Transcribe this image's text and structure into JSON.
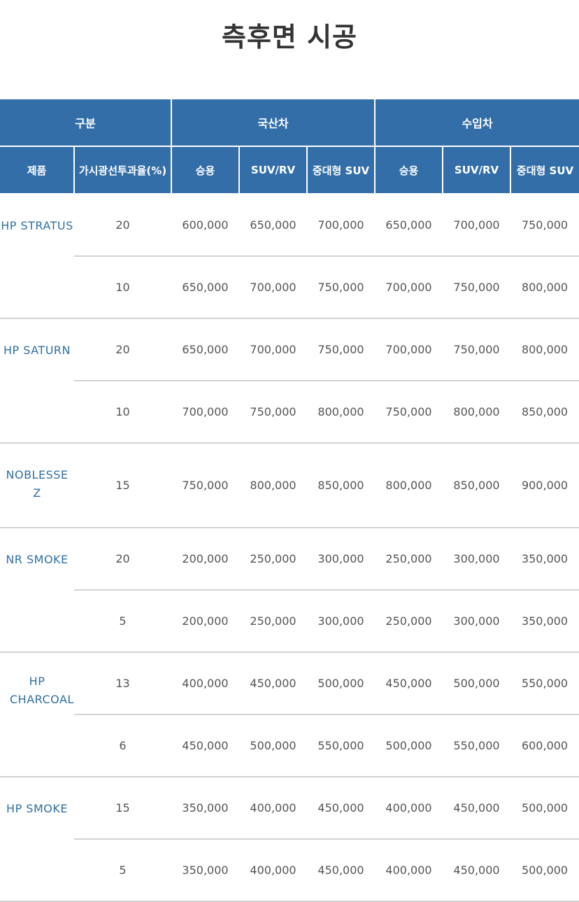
{
  "page": {
    "title": "측후면 시공"
  },
  "table": {
    "group_headers": {
      "category": "구분",
      "domestic": "국산차",
      "imported": "수입차"
    },
    "column_headers": {
      "product": "제품",
      "vlt": "가시광선투과율(%)",
      "passenger": "승용",
      "suv_rv": "SUV/RV",
      "large_suv": "중대형 SUV"
    },
    "products": [
      {
        "name": "HP STRATUS",
        "rows": [
          {
            "vlt": "20",
            "prices": [
              "600,000",
              "650,000",
              "700,000",
              "650,000",
              "700,000",
              "750,000"
            ]
          },
          {
            "vlt": "10",
            "prices": [
              "650,000",
              "700,000",
              "750,000",
              "700,000",
              "750,000",
              "800,000"
            ]
          }
        ]
      },
      {
        "name": "HP SATURN",
        "rows": [
          {
            "vlt": "20",
            "prices": [
              "650,000",
              "700,000",
              "750,000",
              "700,000",
              "750,000",
              "800,000"
            ]
          },
          {
            "vlt": "10",
            "prices": [
              "700,000",
              "750,000",
              "800,000",
              "750,000",
              "800,000",
              "850,000"
            ]
          }
        ]
      },
      {
        "name": "NOBLESSE Z",
        "rows": [
          {
            "vlt": "15",
            "prices": [
              "750,000",
              "800,000",
              "850,000",
              "800,000",
              "850,000",
              "900,000"
            ]
          }
        ]
      },
      {
        "name": "NR SMOKE",
        "rows": [
          {
            "vlt": "20",
            "prices": [
              "200,000",
              "250,000",
              "300,000",
              "250,000",
              "300,000",
              "350,000"
            ]
          },
          {
            "vlt": "5",
            "prices": [
              "200,000",
              "250,000",
              "300,000",
              "250,000",
              "300,000",
              "350,000"
            ]
          }
        ]
      },
      {
        "name": "HP CHARCOAL",
        "rows": [
          {
            "vlt": "13",
            "prices": [
              "400,000",
              "450,000",
              "500,000",
              "450,000",
              "500,000",
              "550,000"
            ]
          },
          {
            "vlt": "6",
            "prices": [
              "450,000",
              "500,000",
              "550,000",
              "500,000",
              "550,000",
              "600,000"
            ]
          }
        ]
      },
      {
        "name": "HP SMOKE",
        "rows": [
          {
            "vlt": "15",
            "prices": [
              "350,000",
              "400,000",
              "450,000",
              "400,000",
              "450,000",
              "500,000"
            ]
          },
          {
            "vlt": "5",
            "prices": [
              "350,000",
              "400,000",
              "450,000",
              "400,000",
              "450,000",
              "500,000"
            ]
          }
        ]
      }
    ]
  },
  "colors": {
    "header_bg": "#336ea8",
    "header_text": "#ffffff",
    "product_text": "#2f6fa4",
    "divider": "#d3d3d3"
  }
}
